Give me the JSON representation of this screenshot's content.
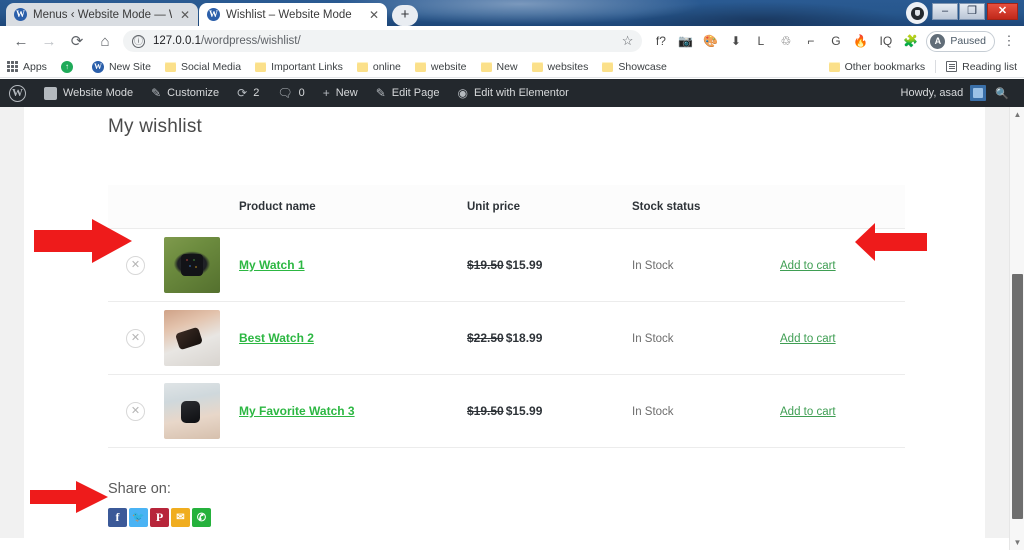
{
  "browser": {
    "tabs": [
      {
        "title": "Menus ‹ Website Mode — Word",
        "favicon": "wordpress-icon",
        "active": false,
        "close": "✕"
      },
      {
        "title": "Wishlist – Website Mode",
        "favicon": "wordpress-icon",
        "active": true,
        "close": "✕"
      }
    ],
    "new_tab_label": "+",
    "window_controls": {
      "minimize": "–",
      "maximize": "❐",
      "close": "✕"
    },
    "nav": {
      "back": "←",
      "forward": "→",
      "reload": "⟳",
      "home": "⌂"
    },
    "omnibox": {
      "info_icon": "ⓘ",
      "url_host": "127.0.0.1",
      "url_path": "/wordpress/wishlist/",
      "star": "☆"
    },
    "extensions": [
      "f?",
      "📷",
      "🎨",
      "⬇",
      "L",
      "♲",
      "⌐",
      "G",
      "🔥",
      "IQ",
      "🧩"
    ],
    "profile": {
      "initial": "A",
      "status": "Paused"
    },
    "menu_label": "⋮",
    "bookmarks": {
      "apps_label": "Apps",
      "items": [
        {
          "label": "",
          "icon": "green-circle-icon"
        },
        {
          "label": "New Site",
          "icon": "wordpress-icon"
        },
        {
          "label": "Social Media",
          "icon": "folder-icon"
        },
        {
          "label": "Important Links",
          "icon": "folder-icon"
        },
        {
          "label": "online",
          "icon": "folder-icon"
        },
        {
          "label": "website",
          "icon": "folder-icon"
        },
        {
          "label": "New",
          "icon": "folder-icon"
        },
        {
          "label": "websites",
          "icon": "folder-icon"
        },
        {
          "label": "Showcase",
          "icon": "folder-icon"
        }
      ],
      "other_bookmarks": "Other bookmarks",
      "reading_list": "Reading list"
    }
  },
  "adminbar": {
    "logo": "W",
    "items": [
      {
        "label": "Website Mode",
        "icon": "house-icon"
      },
      {
        "label": "Customize",
        "icon": "pencil-icon"
      },
      {
        "label": "2",
        "icon": "updates-icon"
      },
      {
        "label": "0",
        "icon": "comment-icon"
      },
      {
        "label": "New",
        "icon": "plus-icon"
      },
      {
        "label": "Edit Page",
        "icon": "pencil-icon"
      },
      {
        "label": "Edit with Elementor",
        "icon": "elementor-icon"
      }
    ],
    "howdy": "Howdy, asad",
    "search_icon": "🔍"
  },
  "page": {
    "title": "My wishlist",
    "table": {
      "headers": [
        "",
        "",
        "Product name",
        "Unit price",
        "Stock status",
        ""
      ],
      "rows": [
        {
          "remove": "✕",
          "thumb": "watch-photo-1",
          "name": "My Watch 1",
          "price_old": "$19.50",
          "price_new": "$15.99",
          "stock": "In Stock",
          "cart": "Add to cart"
        },
        {
          "remove": "✕",
          "thumb": "watch-photo-2",
          "name": "Best Watch 2",
          "price_old": "$22.50",
          "price_new": "$18.99",
          "stock": "In Stock",
          "cart": "Add to cart"
        },
        {
          "remove": "✕",
          "thumb": "watch-photo-3",
          "name": "My Favorite Watch 3",
          "price_old": "$19.50",
          "price_new": "$15.99",
          "stock": "In Stock",
          "cart": "Add to cart"
        }
      ]
    },
    "share": {
      "label": "Share on:",
      "buttons": [
        {
          "name": "facebook",
          "glyph": "f",
          "color": "#3b5998"
        },
        {
          "name": "twitter",
          "glyph": "🐦",
          "color": "#4ab3f4"
        },
        {
          "name": "pinterest",
          "glyph": "P",
          "color": "#b7253a"
        },
        {
          "name": "email",
          "glyph": "✉",
          "color": "#f0ad1f"
        },
        {
          "name": "whatsapp",
          "glyph": "✆",
          "color": "#25b13c"
        }
      ]
    }
  },
  "annotations": {
    "arrow_color": "#ee1b1b",
    "arrows": [
      {
        "name": "arrow-remove-item",
        "direction": "right"
      },
      {
        "name": "arrow-add-to-cart",
        "direction": "left"
      },
      {
        "name": "arrow-share-buttons",
        "direction": "right"
      }
    ]
  },
  "scrollbar": {
    "up": "▲",
    "down": "▼"
  }
}
